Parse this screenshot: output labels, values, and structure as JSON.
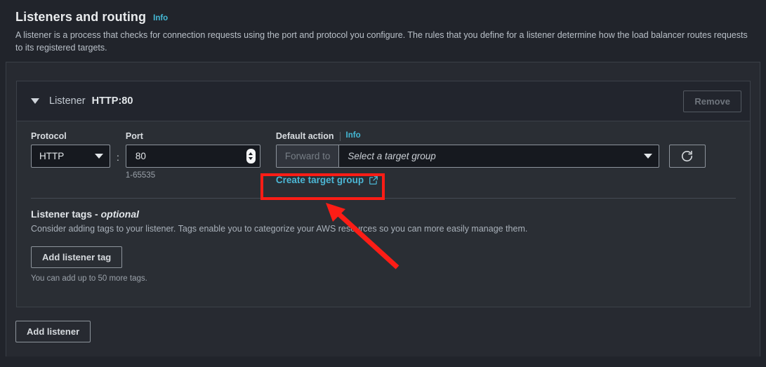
{
  "header": {
    "title": "Listeners and routing",
    "info_label": "Info",
    "description": "A listener is a process that checks for connection requests using the port and protocol you configure. The rules that you define for a listener determine how the load balancer routes requests to its registered targets."
  },
  "listener": {
    "caret_icon": "chevron-down-icon",
    "label": "Listener",
    "value": "HTTP:80",
    "remove_label": "Remove",
    "protocol": {
      "label": "Protocol",
      "value": "HTTP",
      "chevron_icon": "chevron-down-icon"
    },
    "separator": ":",
    "port": {
      "label": "Port",
      "value": "80",
      "hint": "1-65535",
      "spinner_icon": "stepper-icon"
    },
    "default_action": {
      "label": "Default action",
      "info_label": "Info",
      "addon_label": "Forward to",
      "target_group_placeholder": "Select a target group",
      "chevron_icon": "chevron-down-icon",
      "refresh_icon": "refresh-icon",
      "create_link": "Create target group",
      "external_link_icon": "external-link-icon"
    },
    "tags": {
      "title_main": "Listener tags - ",
      "title_optional": "optional",
      "description": "Consider adding tags to your listener. Tags enable you to categorize your AWS resources so you can more easily manage them.",
      "add_button": "Add listener tag",
      "note": "You can add up to 50 more tags."
    }
  },
  "footer": {
    "add_listener_label": "Add listener"
  },
  "annotations": {
    "highlight_color": "#fc1d16",
    "arrow_color": "#fc1d16"
  },
  "colors": {
    "page_bg": "#21242b",
    "panel_bg": "#272a31",
    "card_bg": "#2a2e34",
    "card_head_bg": "#22252d",
    "link": "#4cb6d4",
    "info": "#44b9d6",
    "input_bg": "#16191f",
    "border": "#8d949c"
  }
}
